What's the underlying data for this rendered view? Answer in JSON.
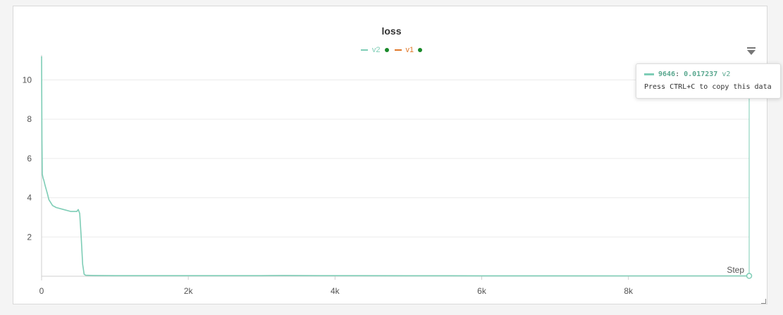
{
  "chart_data": {
    "type": "line",
    "title": "loss",
    "xlabel": "Step",
    "ylabel": "",
    "xlim": [
      0,
      9646
    ],
    "ylim": [
      0,
      11.2
    ],
    "x_ticks": [
      0,
      2000,
      4000,
      6000,
      8000
    ],
    "x_tick_labels": [
      "0",
      "2k",
      "4k",
      "6k",
      "8k"
    ],
    "y_ticks": [
      2,
      4,
      6,
      8,
      10
    ],
    "y_tick_labels": [
      "2",
      "4",
      "6",
      "8",
      "10"
    ],
    "grid": true,
    "legend_position": "top-center",
    "series": [
      {
        "name": "v2",
        "color": "#7ecdb6",
        "status_color": "#1a8a2a",
        "x": [
          0,
          5,
          10,
          20,
          30,
          50,
          80,
          100,
          150,
          200,
          300,
          400,
          480,
          500,
          520,
          540,
          560,
          580,
          600,
          700,
          1000,
          2000,
          3000,
          3300,
          3800,
          4000,
          5000,
          6000,
          7000,
          8000,
          9000,
          9646
        ],
        "y": [
          11.2,
          7.0,
          5.2,
          5.0,
          4.9,
          4.6,
          4.2,
          3.9,
          3.6,
          3.5,
          3.4,
          3.3,
          3.3,
          3.4,
          3.2,
          2.0,
          0.6,
          0.1,
          0.05,
          0.04,
          0.03,
          0.03,
          0.03,
          0.04,
          0.03,
          0.03,
          0.025,
          0.02,
          0.02,
          0.018,
          0.018,
          0.017237
        ]
      },
      {
        "name": "v1",
        "color": "#e0782a",
        "status_color": "#1a8a2a",
        "x": [],
        "y": []
      }
    ]
  },
  "tooltip": {
    "step": "9646",
    "value": "0.017237",
    "series": "v2",
    "hint": "Press CTRL+C to copy this data"
  },
  "icons": {
    "filter": "filter-icon",
    "resize": "resize-handle-icon"
  }
}
